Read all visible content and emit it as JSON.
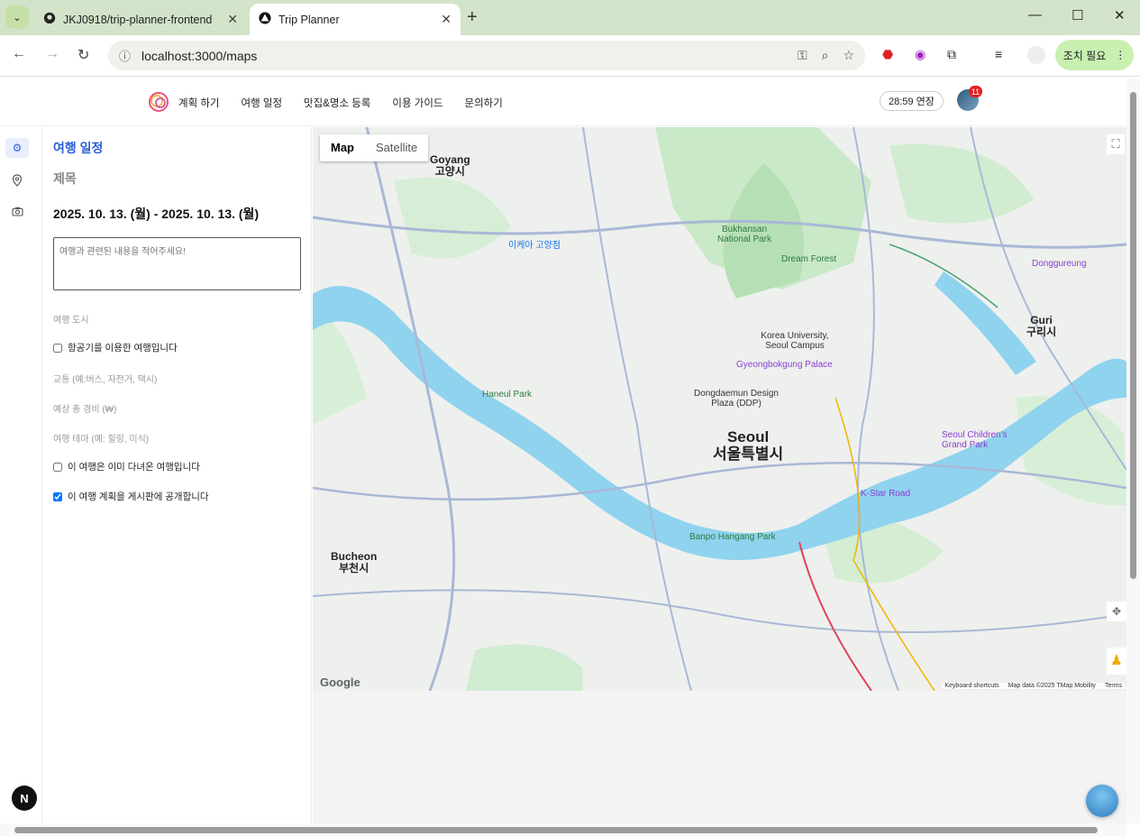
{
  "browser": {
    "tabs": [
      {
        "title": "JKJ0918/trip-planner-frontend",
        "active": false
      },
      {
        "title": "Trip Planner",
        "active": true
      }
    ],
    "url": "localhost:3000/maps",
    "action_button": "조치 필요"
  },
  "header": {
    "nav": [
      "계획 하기",
      "여행 일정",
      "맛집&명소 등록",
      "이용 가이드",
      "문의하기"
    ],
    "timer": "28:59  연장",
    "notification_count": "11"
  },
  "panel": {
    "title": "여행 일정",
    "subtitle": "제목",
    "dates": "2025. 10. 13. (월) - 2025. 10. 13. (월)",
    "memo_placeholder": "여행과 관련된 내용을 적어주세요!",
    "city_placeholder": "여행 도시",
    "flight_label": "항공기를 이용한 여행입니다",
    "transport_placeholder": "교통 (예:버스, 자전거, 택시)",
    "budget_placeholder": "예상 총 경비 (₩)",
    "theme_placeholder": "여행 테마 (예: 힐링, 미식)",
    "visited_label": "이 여행은 이미 다녀온 여행입니다",
    "public_label": "이 여행 계획을 게시판에 공개합니다"
  },
  "map": {
    "type_map": "Map",
    "type_satellite": "Satellite",
    "labels": {
      "seoul_en": "Seoul",
      "seoul_ko": "서울특별시",
      "goyang_en": "Goyang",
      "goyang_ko": "고양시",
      "guri_en": "Guri",
      "guri_ko": "구리시",
      "bucheon_en": "Bucheon",
      "bucheon_ko": "부천시",
      "bukhansan": "Bukhansan National Park",
      "dream_forest": "Dream Forest",
      "korea_univ": "Korea University, Seoul Campus",
      "gyeongbokgung": "Gyeongbokgung Palace",
      "ddp": "Dongdaemun Design Plaza (DDP)",
      "haneul_park": "Haneul Park",
      "childrens_park": "Seoul Children's Grand Park",
      "kstar_road": "K-Star Road",
      "banpo": "Banpo Hangang Park",
      "donggureung": "Donggureung",
      "ikea": "이케아 고양점"
    },
    "attribution": [
      "Keyboard shortcuts",
      "Map data ©2025 TMap Mobility",
      "Terms"
    ],
    "google": "Google"
  },
  "colors": {
    "accent": "#2a5fd6",
    "water": "#8fd3ee",
    "park": "#c9e9c8",
    "road": "#a9b8d6"
  }
}
